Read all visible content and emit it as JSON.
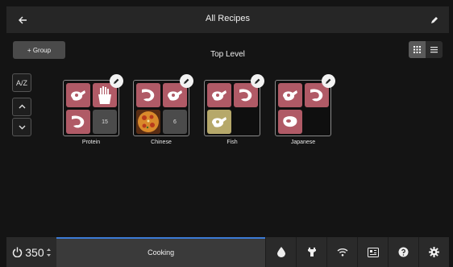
{
  "header": {
    "title": "All Recipes",
    "back_icon": "arrow-left-icon",
    "edit_icon": "pencil-icon"
  },
  "toolbar": {
    "add_group_label": "+ Group",
    "level_title": "Top Level",
    "view_modes": [
      "grid",
      "list"
    ],
    "active_view": "grid"
  },
  "side_controls": {
    "sort_label": "A/Z",
    "up_icon": "chevron-up-icon",
    "down_icon": "chevron-down-icon"
  },
  "groups": [
    {
      "name": "Protein",
      "tiles": [
        "chicken",
        "fries",
        "shrimp"
      ],
      "count": "15"
    },
    {
      "name": "Chinese",
      "tiles": [
        "shrimp",
        "chicken",
        "pizza-photo"
      ],
      "count": "6"
    },
    {
      "name": "Fish",
      "tiles": [
        "chicken",
        "shrimp",
        "chicken-gold"
      ],
      "count": ""
    },
    {
      "name": "Japanese",
      "tiles": [
        "chicken",
        "shrimp",
        "steak"
      ],
      "count": ""
    }
  ],
  "bottom": {
    "temperature": "350",
    "temperature_unit_icon": "updown-arrows-icon",
    "cooking_label": "Cooking",
    "cooking_progress": 1.0,
    "icons": [
      "water-drop-icon",
      "probe-icon",
      "wifi-icon",
      "recipe-book-icon",
      "help-icon",
      "settings-icon"
    ]
  },
  "colors": {
    "tile": "#b05a66",
    "accent": "#3b7bd6",
    "bar": "#262626"
  }
}
